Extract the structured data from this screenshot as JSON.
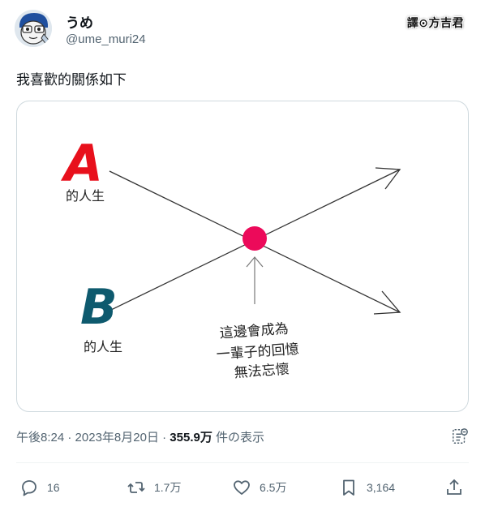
{
  "user": {
    "display_name": "うめ",
    "handle": "@ume_muri24",
    "avatar": "avatar-icon"
  },
  "watermark": "譯⊙方吉君",
  "tweet": {
    "text": "我喜歡的關係如下"
  },
  "media": {
    "label_a_letter": "A",
    "label_a_text": "的人生",
    "label_b_letter": "B",
    "label_b_text": "的人生",
    "annotation_lines": [
      "這邊會成為",
      "一輩子的回憶",
      "無法忘懷"
    ],
    "colors": {
      "a": "#e8101c",
      "b": "#0e5a6e",
      "dot": "#ec0a5a"
    }
  },
  "meta": {
    "time": "午後8:24",
    "separator": " · ",
    "date": "2023年8月20日",
    "separator2": " · ",
    "views": "355.9万",
    "views_label": " 件の表示",
    "analytics_icon": "analytics-icon"
  },
  "actions": {
    "reply": {
      "icon": "reply-icon",
      "count": "16"
    },
    "retweet": {
      "icon": "retweet-icon",
      "count": "1.7万"
    },
    "like": {
      "icon": "heart-icon",
      "count": "6.5万"
    },
    "bookmark": {
      "icon": "bookmark-icon",
      "count": "3,164"
    },
    "share": {
      "icon": "share-icon"
    }
  }
}
